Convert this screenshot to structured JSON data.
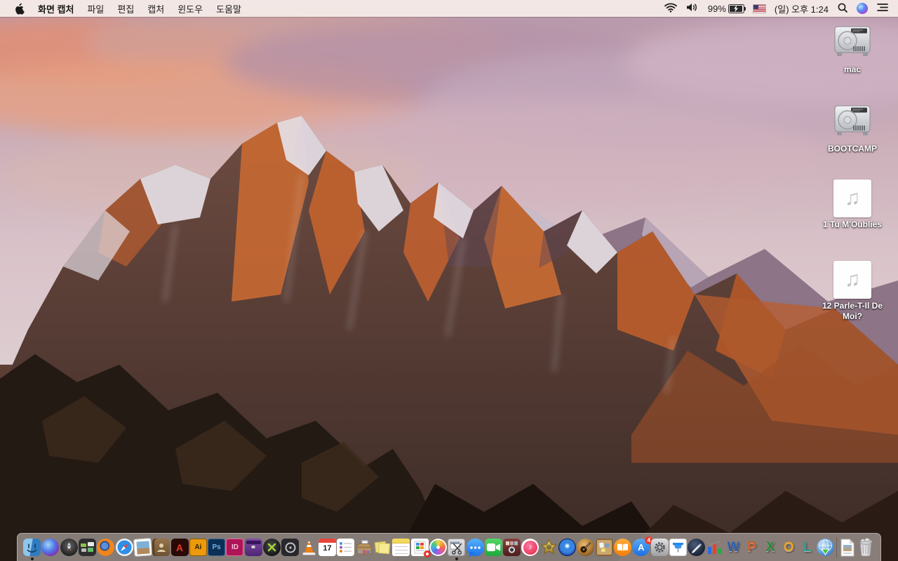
{
  "menu_bar": {
    "app_name": "화면 캡처",
    "menus": [
      "파일",
      "편집",
      "캡처",
      "윈도우",
      "도움말"
    ],
    "status": {
      "battery_percent": "99%",
      "clock": "(일) 오후 1:24",
      "icons": [
        "wifi-icon",
        "volume-icon",
        "battery-charging-icon",
        "us-flag-icon",
        "spotlight-search-icon",
        "siri-icon",
        "notification-center-icon"
      ]
    }
  },
  "desktop": {
    "icons": [
      {
        "label": "mac",
        "type": "internal-hard-drive"
      },
      {
        "label": "BOOTCAMP",
        "type": "internal-hard-drive"
      },
      {
        "label": "1 Tu M'Oublies",
        "type": "audio-file"
      },
      {
        "label": "12 Parle-T-Il De Moi?",
        "type": "audio-file"
      }
    ]
  },
  "dock": {
    "items": [
      {
        "name": "finder",
        "running": true
      },
      {
        "name": "siri"
      },
      {
        "name": "launchpad"
      },
      {
        "name": "mission-control"
      },
      {
        "name": "firefox"
      },
      {
        "name": "safari"
      },
      {
        "name": "preview"
      },
      {
        "name": "contacts"
      },
      {
        "name": "acrobat-reader",
        "glyph": "A"
      },
      {
        "name": "illustrator",
        "glyph": "Ai"
      },
      {
        "name": "photoshop",
        "glyph": "Ps"
      },
      {
        "name": "indesign",
        "glyph": "ID"
      },
      {
        "name": "toolbox-app"
      },
      {
        "name": "quicksilver"
      },
      {
        "name": "disk-tool"
      },
      {
        "name": "vlc"
      },
      {
        "name": "calendar",
        "glyph": "17"
      },
      {
        "name": "reminders"
      },
      {
        "name": "archive-utility"
      },
      {
        "name": "stickies"
      },
      {
        "name": "notes"
      },
      {
        "name": "installer-document"
      },
      {
        "name": "photos"
      },
      {
        "name": "grab-screen-capture",
        "running": true
      },
      {
        "name": "messages"
      },
      {
        "name": "facetime"
      },
      {
        "name": "photo-booth"
      },
      {
        "name": "itunes",
        "glyph": "♪"
      },
      {
        "name": "imovie-legacy"
      },
      {
        "name": "disc-app"
      },
      {
        "name": "garageband"
      },
      {
        "name": "corkboard-app"
      },
      {
        "name": "ibooks"
      },
      {
        "name": "app-store",
        "glyph": "A",
        "badge": "4"
      },
      {
        "name": "system-preferences"
      },
      {
        "name": "keynote"
      },
      {
        "name": "pages-legacy"
      },
      {
        "name": "office-chart"
      },
      {
        "name": "word",
        "glyph": "W"
      },
      {
        "name": "powerpoint",
        "glyph": "P"
      },
      {
        "name": "excel",
        "glyph": "X"
      },
      {
        "name": "outlook",
        "glyph": "O"
      },
      {
        "name": "lync",
        "glyph": "L"
      },
      {
        "name": "download-manager"
      }
    ],
    "trailing": [
      {
        "name": "image-file"
      },
      {
        "name": "trash-full"
      }
    ]
  },
  "colors": {
    "menubar_bg": "#f5eae7",
    "dock_bg": "rgba(213,206,202,0.55)"
  }
}
